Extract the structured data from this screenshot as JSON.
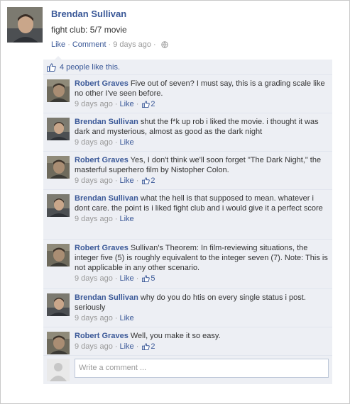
{
  "status": {
    "author": "Brendan Sullivan",
    "text": "fight club: 5/7 movie",
    "like_label": "Like",
    "comment_label": "Comment",
    "time": "9 days ago"
  },
  "likes": {
    "text": "4 people like this."
  },
  "comments": [
    {
      "author": "Robert Graves",
      "text": "Five out of seven? I must say, this is a grading scale like no other I've seen before.",
      "time": "9 days ago",
      "like_label": "Like",
      "like_count": "2"
    },
    {
      "author": "Brendan Sullivan",
      "text": "shut the f*k up rob i liked the movie. i thought it was dark and mysterious, almost as good as the dark night",
      "time": "9 days ago",
      "like_label": "Like",
      "like_count": ""
    },
    {
      "author": "Robert Graves",
      "text": "Yes, I don't think we'll soon forget \"The Dark Night,\" the masterful superhero film by Nistopher Colon.",
      "time": "9 days ago",
      "like_label": "Like",
      "like_count": "2"
    },
    {
      "author": "Brendan Sullivan",
      "text": "what the hell is that supposed to mean. whatever i dont care. the point is i liked fight club and i would give it a perfect score",
      "time": "9 days ago",
      "like_label": "Like",
      "like_count": ""
    },
    {
      "author": "Robert Graves",
      "text": "Sullivan's Theorem: In film-reviewing situations, the integer five (5) is roughly equivalent to the integer seven (7). Note: This is not applicable in any other scenario.",
      "time": "9 days ago",
      "like_label": "Like",
      "like_count": "5"
    },
    {
      "author": "Brendan Sullivan",
      "text": "why do you do htis on every single status i post. seriously",
      "time": "9 days ago",
      "like_label": "Like",
      "like_count": ""
    },
    {
      "author": "Robert Graves",
      "text": "Well, you make it so easy.",
      "time": "9 days ago",
      "like_label": "Like",
      "like_count": "2"
    }
  ],
  "compose": {
    "placeholder": "Write a comment ..."
  },
  "colors": {
    "link": "#3b5998",
    "feedback_bg": "#edeff4",
    "meta": "#999999"
  }
}
